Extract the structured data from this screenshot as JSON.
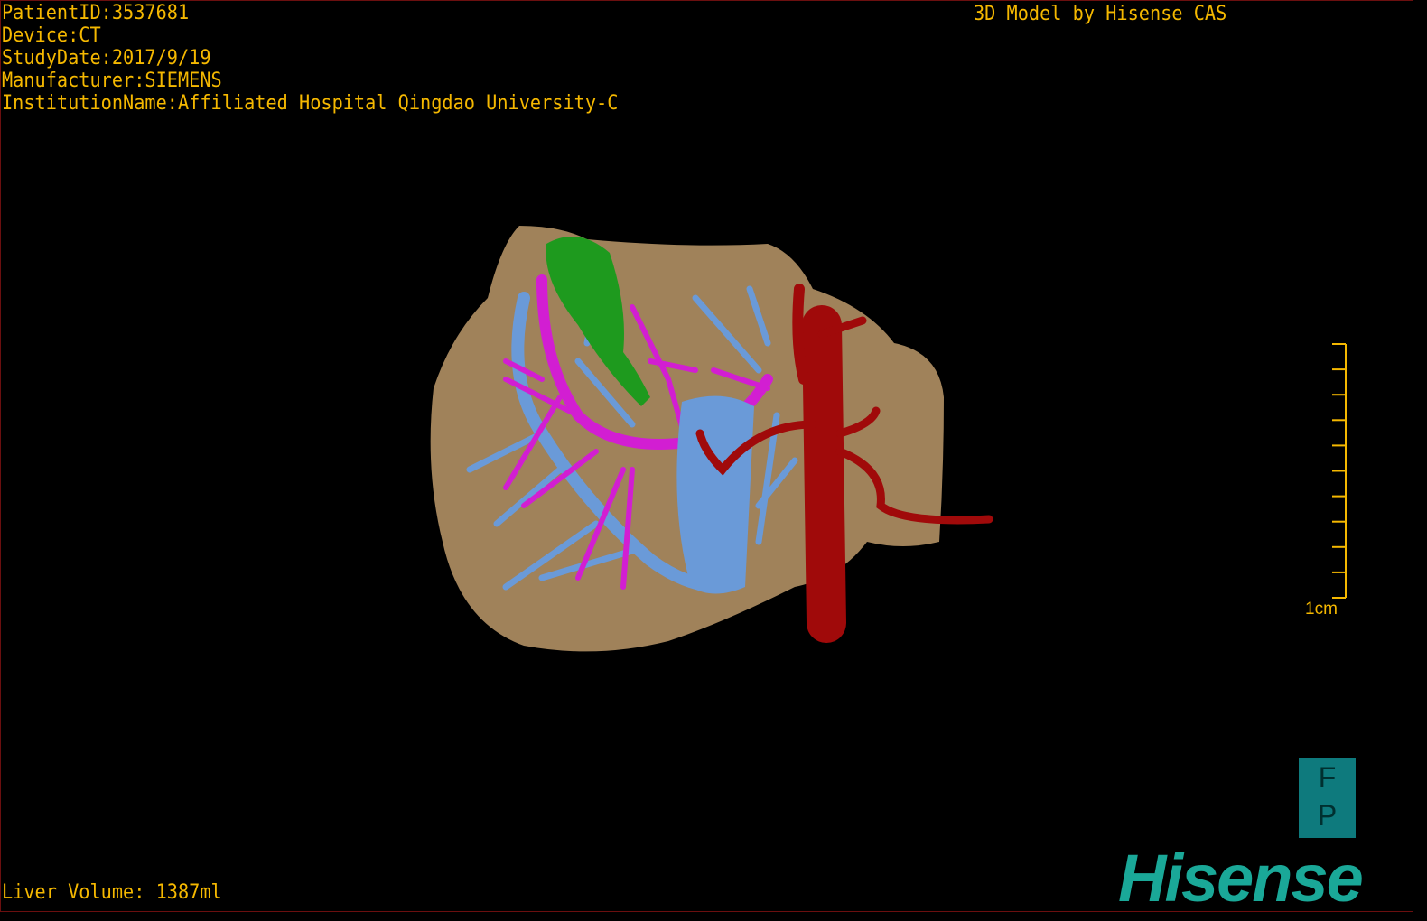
{
  "overlay": {
    "patient_id": "PatientID:3537681",
    "device": "Device:CT",
    "study_date": "StudyDate:2017/9/19",
    "manufacturer": "Manufacturer:SIEMENS",
    "institution": "InstitutionName:Affiliated Hospital Qingdao University-C",
    "brand_text": "3D Model by Hisense CAS",
    "liver_volume": "Liver Volume: 1387ml"
  },
  "scale_bar": {
    "label": "1cm",
    "ticks": 10
  },
  "orientation": {
    "top": "F",
    "bottom": "P"
  },
  "logo": "Hisense",
  "colors": {
    "text": "#f5b800",
    "liver": "#a0825a",
    "portal_vein": "#d21ed2",
    "hepatic_vein": "#6a9ad8",
    "artery_ivc": "#a00a0a",
    "gallbladder": "#1e9a1e",
    "logo": "#1aa898"
  }
}
